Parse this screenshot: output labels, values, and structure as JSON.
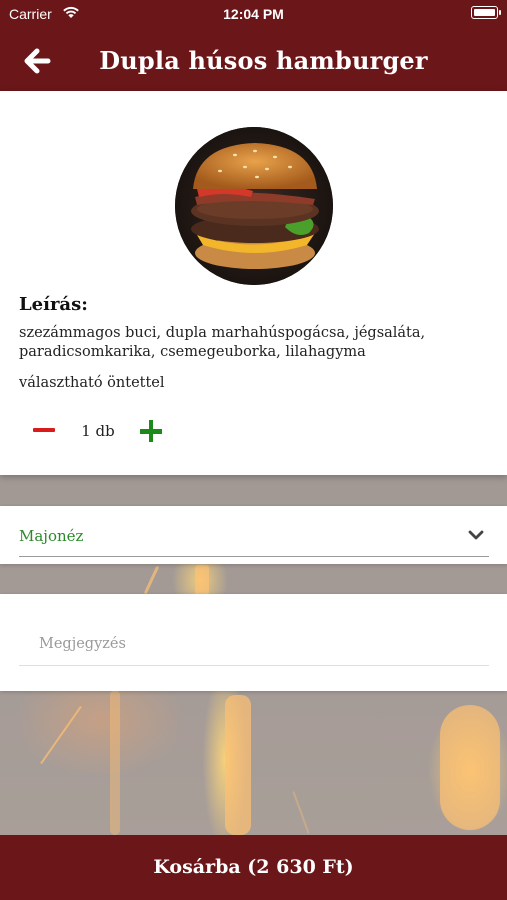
{
  "status_bar": {
    "carrier": "Carrier",
    "time": "12:04 PM"
  },
  "nav": {
    "title": "Dupla húsos hamburger",
    "back_icon": "arrow-left-icon"
  },
  "product": {
    "image": "burger-photo",
    "description_heading": "Leírás:",
    "description": "szezámmagos buci, dupla marhahúspogácsa, jégsaláta, paradicsomkarika, csemegeuborka, lilahagyma",
    "option_note": "választható öntettel",
    "quantity_label": "1 db"
  },
  "sauce_select": {
    "selected": "Majonéz",
    "icon": "chevron-down-icon"
  },
  "note_field": {
    "placeholder": "Megjegyzés",
    "value": ""
  },
  "cart_button": {
    "label": "Kosárba (2 630 Ft)"
  },
  "colors": {
    "brand": "#6b1618",
    "minus": "#d81b1b",
    "plus": "#1b8a1b",
    "selected_option": "#2a8a2a"
  }
}
